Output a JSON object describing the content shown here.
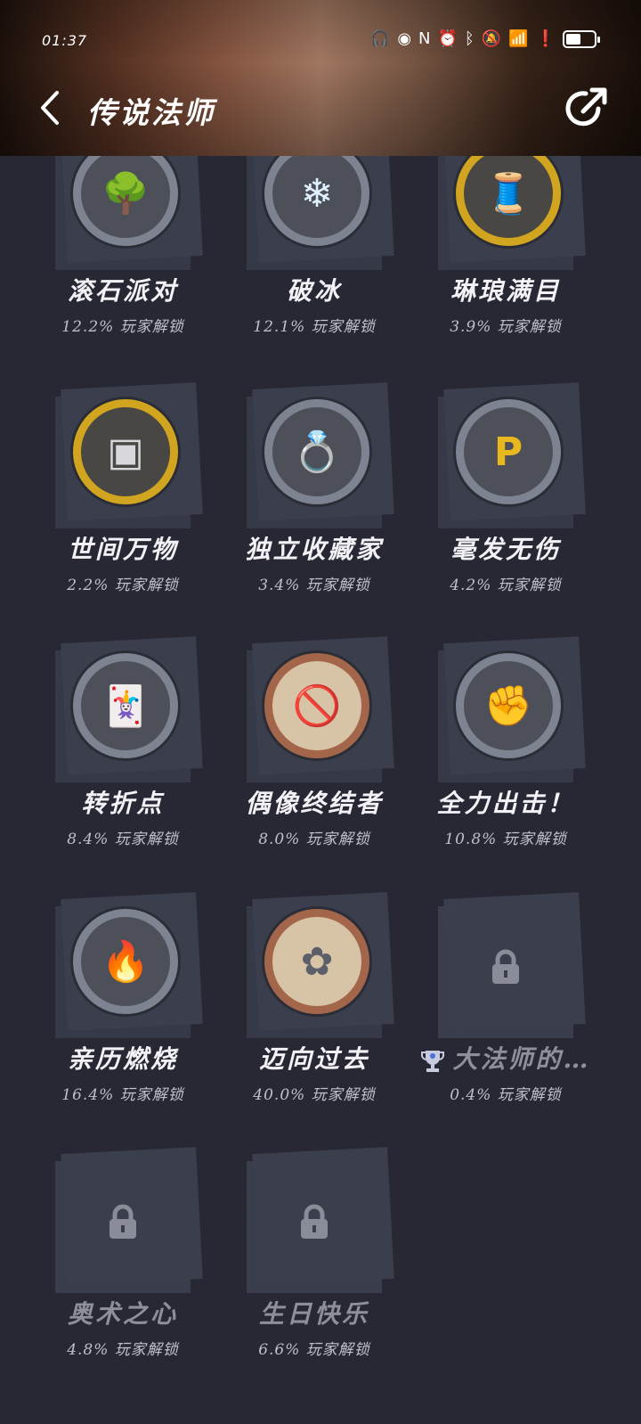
{
  "status_bar": {
    "time": "01:37"
  },
  "header": {
    "title": "传说法师"
  },
  "achievements": [
    {
      "name": "滚石派对",
      "percent": "12.2% 玩家解锁",
      "icon": "tree-stump-icon",
      "glyph": "🌳",
      "ring": "silver"
    },
    {
      "name": "破冰",
      "percent": "12.1% 玩家解锁",
      "icon": "ice-crystal-icon",
      "glyph": "❄",
      "ring": "silver"
    },
    {
      "name": "琳琅满目",
      "percent": "3.9% 玩家解锁",
      "icon": "thread-spool-icon",
      "glyph": "🧵",
      "ring": "gold"
    },
    {
      "name": "世间万物",
      "percent": "2.2% 玩家解锁",
      "icon": "treasure-chest-icon",
      "glyph": "▣",
      "ring": "gold"
    },
    {
      "name": "独立收藏家",
      "percent": "3.4% 玩家解锁",
      "icon": "relic-pile-icon",
      "glyph": "💍",
      "ring": "silver"
    },
    {
      "name": "毫发无伤",
      "percent": "4.2% 玩家解锁",
      "icon": "p-block-icon",
      "glyph": "P",
      "ring": "silver"
    },
    {
      "name": "转折点",
      "percent": "8.4% 玩家解锁",
      "icon": "spell-cards-icon",
      "glyph": "🃏",
      "ring": "silver"
    },
    {
      "name": "偶像终结者",
      "percent": "8.0% 玩家解锁",
      "icon": "easel-icon",
      "glyph": "🚫",
      "ring": "bronze"
    },
    {
      "name": "全力出击！",
      "percent": "10.8% 玩家解锁",
      "icon": "fists-icon",
      "glyph": "✊",
      "ring": "silver"
    },
    {
      "name": "亲历燃烧",
      "percent": "16.4% 玩家解锁",
      "icon": "flame-icon",
      "glyph": "🔥",
      "ring": "silver"
    },
    {
      "name": "迈向过去",
      "percent": "40.0% 玩家解锁",
      "icon": "stone-seal-icon",
      "glyph": "✿",
      "ring": "bronze"
    },
    {
      "name": "大法师的…",
      "percent": "0.4% 玩家解锁",
      "icon": "lock-icon",
      "glyph": "",
      "ring": "none",
      "locked": true,
      "trophy": true
    },
    {
      "name": "奥术之心",
      "percent": "4.8% 玩家解锁",
      "icon": "lock-icon",
      "glyph": "",
      "ring": "none",
      "locked": true
    },
    {
      "name": "生日快乐",
      "percent": "6.6% 玩家解锁",
      "icon": "lock-icon",
      "glyph": "",
      "ring": "none",
      "locked": true
    }
  ]
}
